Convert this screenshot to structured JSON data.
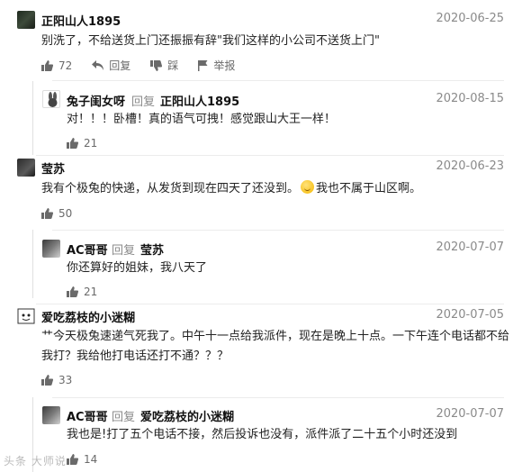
{
  "comments": [
    {
      "username": "正阳山人1895",
      "date": "2020-06-25",
      "text": "别洗了，不给送货上门还振振有辞\"我们这样的小公司不送货上门\"",
      "likes": "72",
      "reply_label": "回复",
      "dislike_label": "踩",
      "report_label": "举报",
      "reply": {
        "username": "兔子闺女呀",
        "reply_word": "回复",
        "target": "正阳山人1895",
        "date": "2020-08-15",
        "text": "对！！！卧槽！真的语气可拽！感觉跟山大王一样！",
        "likes": "21"
      }
    },
    {
      "username": "莹苏",
      "date": "2020-06-23",
      "text_before": "我有个极兔的快递，从发货到现在四天了还没到。",
      "text_after": "我也不属于山区啊。",
      "likes": "50",
      "reply": {
        "username": "AC哥哥",
        "reply_word": "回复",
        "target": "莹苏",
        "date": "2020-07-07",
        "text": "你还算好的姐妹，我八天了",
        "likes": "21"
      }
    },
    {
      "username": "爱吃荔枝的小迷糊",
      "date": "2020-07-05",
      "text_line1": "艹今天极兔速递气死我了。中午十一点给我派件，现在是晚上十点。一下午连个电话都不给",
      "text_line2": "我打？我给他打电话还打不通？？？",
      "likes": "33",
      "reply": {
        "username": "AC哥哥",
        "reply_word": "回复",
        "target": "爱吃荔枝的小迷糊",
        "date": "2020-07-07",
        "text": "我也是!打了五个电话不接，然后投诉也没有，派件派了二十五个小时还没到",
        "likes": "14"
      }
    }
  ],
  "watermark": "头条 大师说"
}
